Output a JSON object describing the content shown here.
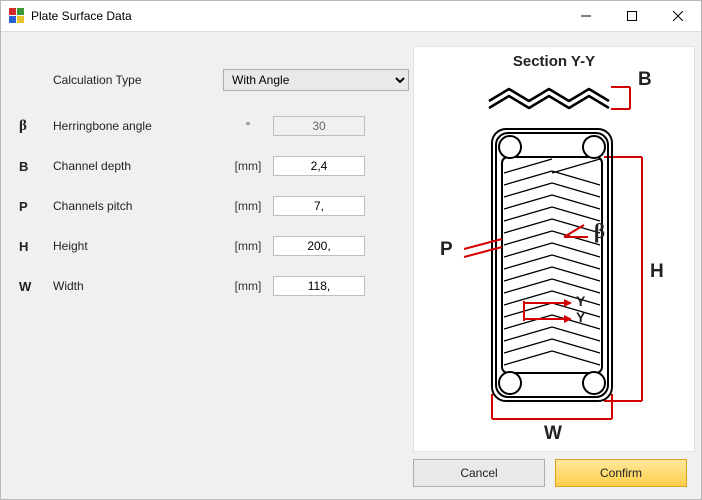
{
  "window": {
    "title": "Plate Surface Data"
  },
  "form": {
    "calc_type_label": "Calculation Type",
    "calc_type_value": "With Angle",
    "rows": [
      {
        "sym": "β",
        "label": "Herringbone angle",
        "unit": "°",
        "value": "30",
        "disabled": true
      },
      {
        "sym": "B",
        "label": "Channel depth",
        "unit": "[mm]",
        "value": "2,4",
        "disabled": false
      },
      {
        "sym": "P",
        "label": "Channels pitch",
        "unit": "[mm]",
        "value": "7,",
        "disabled": false
      },
      {
        "sym": "H",
        "label": "Height",
        "unit": "[mm]",
        "value": "200,",
        "disabled": false
      },
      {
        "sym": "W",
        "label": "Width",
        "unit": "[mm]",
        "value": "118,",
        "disabled": false
      }
    ]
  },
  "figure": {
    "title": "Section Y-Y",
    "labels": {
      "B": "B",
      "P": "P",
      "beta": "β",
      "H": "H",
      "W": "W",
      "Y1": "Y",
      "Y2": "Y"
    }
  },
  "buttons": {
    "cancel": "Cancel",
    "confirm": "Confirm"
  }
}
